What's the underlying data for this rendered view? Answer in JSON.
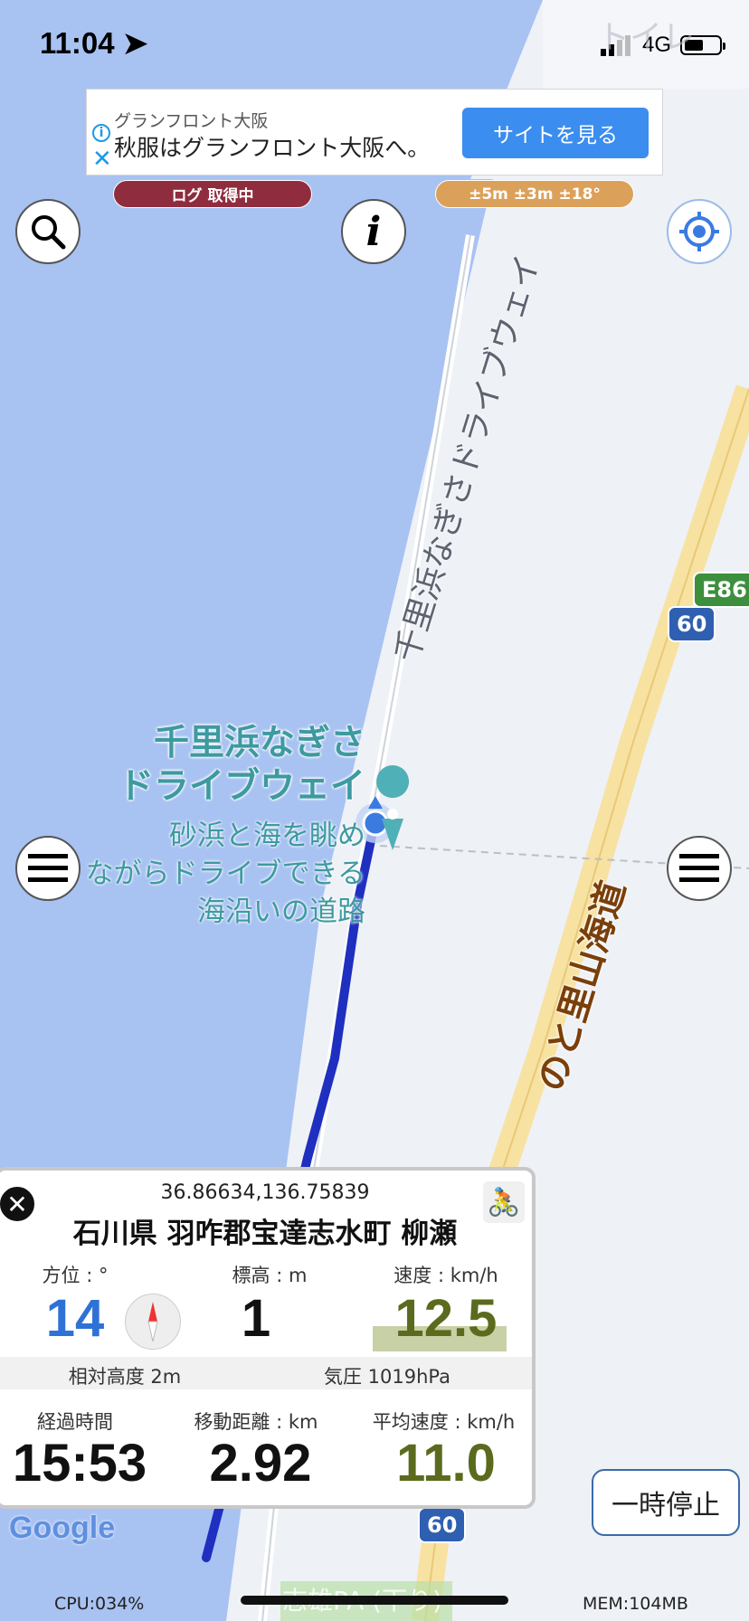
{
  "status": {
    "time": "11:04",
    "network": "4G",
    "battery_level": 0.55
  },
  "ad": {
    "sponsor": "グランフロント大阪",
    "headline": "秋服はグランフロント大阪へ。",
    "button_label": "サイトを見る",
    "info_icon": "i",
    "close_icon": "✕"
  },
  "pills": {
    "logging": "ログ 取得中",
    "accuracy": "±5m ±3m ±18°"
  },
  "map": {
    "road_label": "千里浜なぎさドライブウェイ",
    "poi_title_lines": [
      "千里浜なぎさ",
      "ドライブウェイ"
    ],
    "poi_desc_lines": [
      "砂浜と海を眺め",
      "ながらドライブできる",
      "海沿いの道路"
    ],
    "highway_label": "のと里山海道",
    "route_60_top": "60",
    "route_e86": "E86",
    "route_60_bottom": "60",
    "faded_top_label": "トイレ",
    "faded_bottom_label": "志雄PA (下り)",
    "google": "Google"
  },
  "panel": {
    "coords": "36.86634,136.75839",
    "address": "石川県 羽咋郡宝達志水町 柳瀬",
    "heading_label": "方位 : °",
    "heading_value": "14",
    "altitude_label": "標高 : m",
    "altitude_value": "1",
    "speed_label": "速度 : km/h",
    "speed_value": "12.5",
    "relative_alt": "相対高度 2m",
    "pressure": "気圧 1019hPa",
    "elapsed_label": "経過時間",
    "elapsed_value": "15:53",
    "distance_label": "移動距離 : km",
    "distance_value": "2.92",
    "avg_label": "平均速度 : km/h",
    "avg_value": "11.0",
    "close": "✕"
  },
  "pause_button": "一時停止",
  "footer": {
    "cpu": "CPU:034%",
    "mem": "MEM:104MB"
  },
  "colors": {
    "sea": "#a8c2f2",
    "land": "#eef1f6",
    "track": "#1f2fc0",
    "heading": "#2f72d6",
    "speed": "#5a6b1e",
    "poi": "#3d9aa0",
    "highway_text": "#7a3f0a"
  }
}
